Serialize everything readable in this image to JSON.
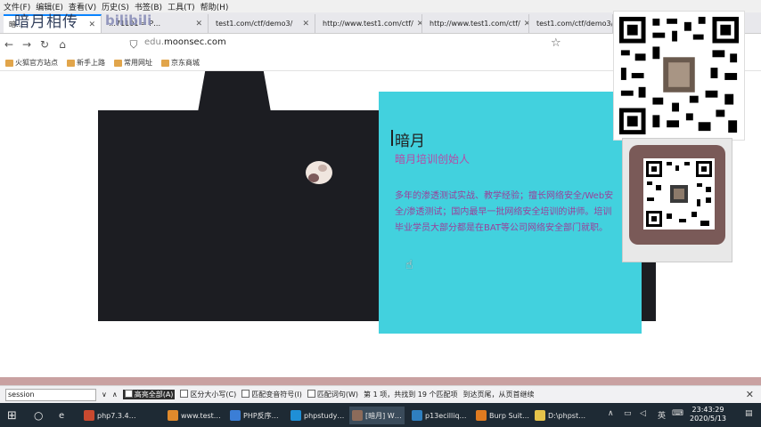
{
  "menubar": [
    "文件(F)",
    "编辑(E)",
    "查看(V)",
    "历史(S)",
    "书签(B)",
    "工具(T)",
    "帮助(H)"
  ],
  "watermark": {
    "text": "暗月相传",
    "logo": "bilibili"
  },
  "tabs": [
    {
      "label": "暗…",
      "active": true
    },
    {
      "label": "…71101 = P…"
    },
    {
      "label": "test1.com/ctf/demo3/"
    },
    {
      "label": "http://www.test1.com/ctf/"
    },
    {
      "label": "http://www.test1.com/ctf/"
    },
    {
      "label": "test1.com/ctf/demo3/"
    }
  ],
  "url": {
    "prefix": "edu.",
    "domain": "moonsec.com"
  },
  "bookmarks": [
    "火狐官方站点",
    "新手上路",
    "常用网址",
    "京东商城"
  ],
  "card": {
    "name": "暗月",
    "role": "暗月培训创始人",
    "description": "多年的渗透测试实战、教学经验；擅长网络安全/Web安全/渗透测试；国内最早一批网络安全培训的讲师。培训毕业学员大部分都是在BAT等公司网络安全部门就职。"
  },
  "findbar": {
    "value": "session",
    "buttons": [
      "高亮全部(A)",
      "区分大小写(C)",
      "匹配变音符号(I)",
      "匹配词句(W)"
    ],
    "status": "第 1 项，共找到 19 个匹配项",
    "notice": "到达页尾，从页首继续"
  },
  "taskbar": {
    "items": [
      "php7.3.4…",
      "www.test…",
      "PHP反序…",
      "phpstudy…",
      "[暗月] W…",
      "p13ecilliq…",
      "Burp Suit…",
      "D:\\phpst…"
    ],
    "time": "23:43:29",
    "date": "2020/5/13",
    "ime": "英"
  },
  "colors": {
    "card": "#42d1de",
    "accent": "#b64aa6",
    "taskbar": "#1e2a34"
  }
}
